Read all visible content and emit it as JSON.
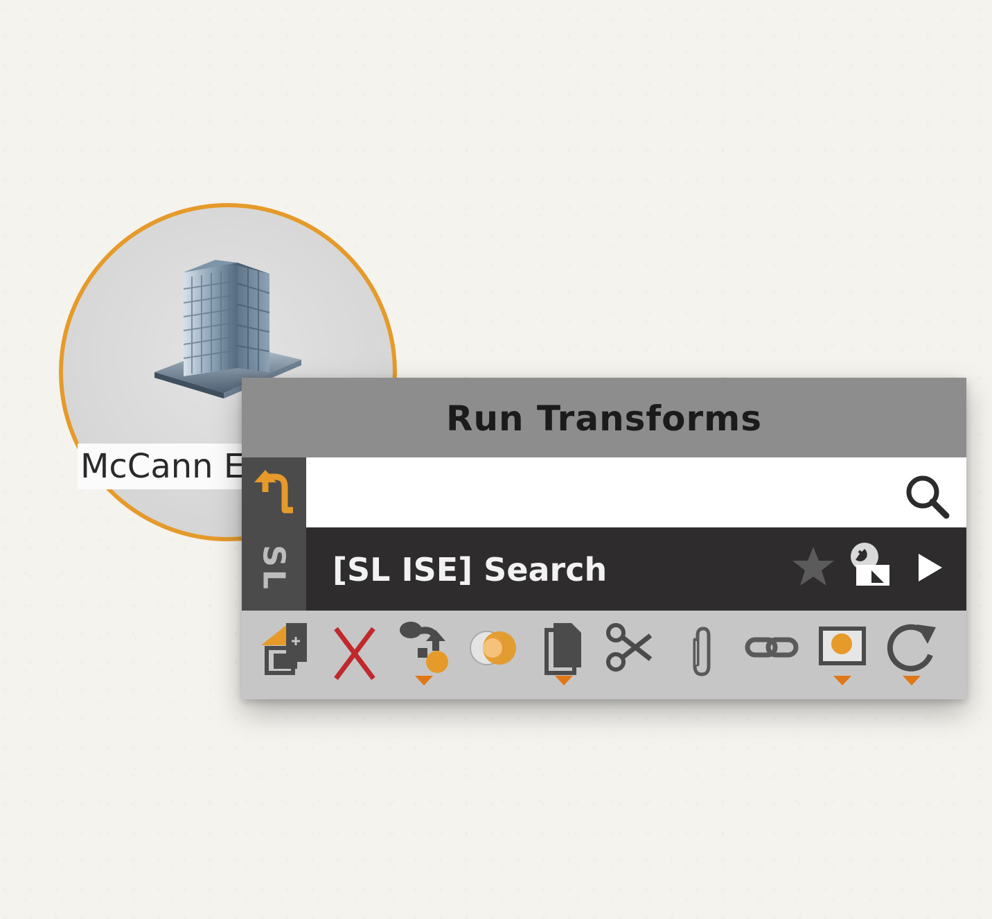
{
  "entity": {
    "label": "McCann E",
    "icon": "office-building-icon",
    "accent_color": "#e59a2a"
  },
  "popup": {
    "title": "Run Transforms",
    "side_tab": {
      "label": "SL",
      "back_icon": "back-arrow-icon"
    },
    "search": {
      "value": "",
      "placeholder": "",
      "icon": "search-icon"
    },
    "transform": {
      "label": "[SL ISE] Search",
      "icons": [
        "star-icon",
        "settings-icon",
        "run-arrow-icon"
      ]
    },
    "toolbar": [
      {
        "name": "change-type-icon"
      },
      {
        "name": "delete-icon"
      },
      {
        "name": "merge-icon",
        "has_dropdown": true
      },
      {
        "name": "select-icon"
      },
      {
        "name": "copy-icon",
        "has_dropdown": true
      },
      {
        "name": "cut-icon"
      },
      {
        "name": "attach-icon"
      },
      {
        "name": "link-icon"
      },
      {
        "name": "pin-icon",
        "has_dropdown": true
      },
      {
        "name": "rerun-icon",
        "has_dropdown": true
      }
    ]
  },
  "colors": {
    "accent": "#e59a2a",
    "title_bar": "#8e8d8e",
    "transform_row": "#2e2c2d",
    "toolbar": "#c6c6c6",
    "delete": "#c0292b"
  }
}
